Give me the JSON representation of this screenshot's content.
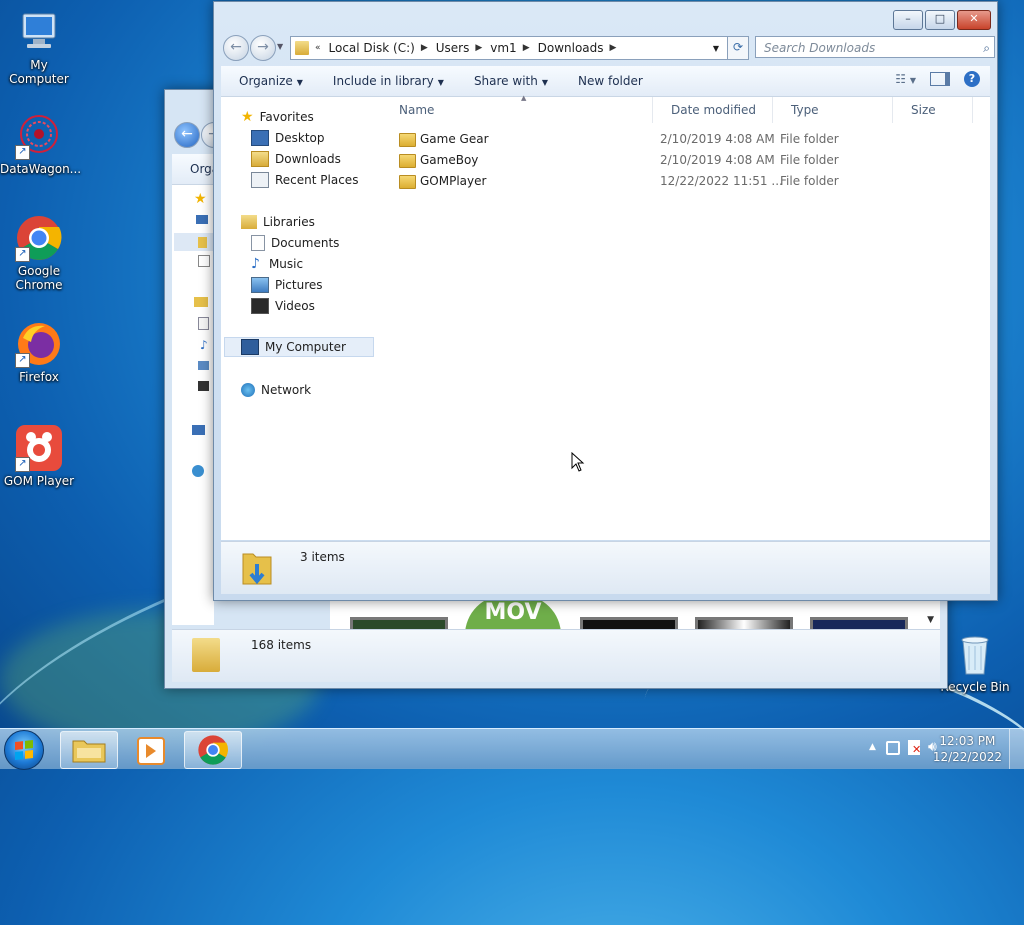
{
  "desktop": {
    "icons": [
      {
        "label": "My Computer",
        "icon": "computer-icon"
      },
      {
        "label": "DataWagon...",
        "icon": "datawagon-icon"
      },
      {
        "label": "Google Chrome",
        "icon": "chrome-icon"
      },
      {
        "label": "Firefox",
        "icon": "firefox-icon"
      },
      {
        "label": "GOM Player",
        "icon": "gom-player-icon"
      },
      {
        "label": "Recycle Bin",
        "icon": "recycle-bin-icon"
      }
    ]
  },
  "back_window": {
    "organize_label": "Orga",
    "status": "168 items",
    "thumbnail_badge": "MOV"
  },
  "window": {
    "title_buttons": {
      "minimize": "–",
      "maximize": "□",
      "close": "✕"
    },
    "address": {
      "crumbs": [
        "Local Disk (C:)",
        "Users",
        "vm1",
        "Downloads"
      ]
    },
    "search": {
      "placeholder": "Search Downloads"
    },
    "toolbar": {
      "organize": "Organize",
      "include_in_library": "Include in library",
      "share_with": "Share with",
      "new_folder": "New folder",
      "help": "?"
    },
    "nav": {
      "favorites": "Favorites",
      "desktop": "Desktop",
      "downloads": "Downloads",
      "recent_places": "Recent Places",
      "libraries": "Libraries",
      "documents": "Documents",
      "music": "Music",
      "pictures": "Pictures",
      "videos": "Videos",
      "my_computer": "My Computer",
      "network": "Network"
    },
    "columns": {
      "name": "Name",
      "date_modified": "Date modified",
      "type": "Type",
      "size": "Size"
    },
    "files": [
      {
        "name": "Game Gear",
        "date": "2/10/2019 4:08 AM",
        "type": "File folder",
        "size": ""
      },
      {
        "name": "GameBoy",
        "date": "2/10/2019 4:08 AM",
        "type": "File folder",
        "size": ""
      },
      {
        "name": "GOMPlayer",
        "date": "12/22/2022 11:51 ...",
        "type": "File folder",
        "size": ""
      }
    ],
    "status": "3 items"
  },
  "taskbar": {
    "time": "12:03 PM",
    "date": "12/22/2022"
  },
  "colors": {
    "accent": "#1d7ad6",
    "close_button": "#c8432b",
    "folder": "#e6c04a"
  }
}
